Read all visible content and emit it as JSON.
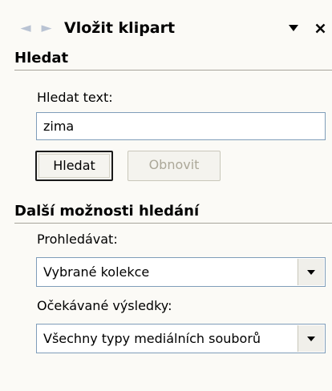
{
  "pane": {
    "title": "Vložit klipart",
    "nav_back_icon": "arrow-left-icon",
    "nav_forward_icon": "arrow-right-icon",
    "menu_icon": "triangle-down-icon",
    "close_icon": "close-icon"
  },
  "search_section": {
    "header": "Hledat",
    "text_label": "Hledat text:",
    "text_value": "zima",
    "search_button": "Hledat",
    "refresh_button": "Obnovit"
  },
  "more_section": {
    "header": "Další možnosti hledání",
    "browse_label": "Prohledávat:",
    "browse_value": "Vybrané kolekce",
    "results_label": "Očekávané výsledky:",
    "results_value": "Všechny typy mediálních souborů"
  },
  "colors": {
    "pane_background": "#fbfaf6",
    "input_border": "#7f9db9",
    "disabled_text": "#aca899",
    "nav_arrow": "#b9c3d3"
  }
}
